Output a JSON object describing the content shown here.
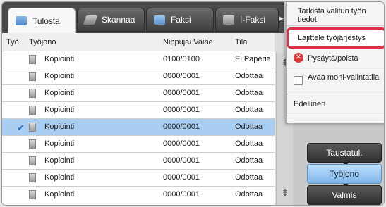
{
  "tabs": [
    {
      "label": "Tulosta",
      "icon": "print-icon",
      "active": true
    },
    {
      "label": "Skannaa",
      "icon": "scan-icon",
      "active": false
    },
    {
      "label": "Faksi",
      "icon": "fax-icon",
      "active": false
    },
    {
      "label": "I-Faksi",
      "icon": "ifax-icon",
      "active": false
    }
  ],
  "table": {
    "headers": [
      "Työ",
      "Työjono",
      "Nippuja/ Vaihe",
      "Tila"
    ],
    "rows": [
      {
        "name": "Kopiointi",
        "count": "0100/0100",
        "status": "Ei Paperia"
      },
      {
        "name": "Kopiointi",
        "count": "0000/0001",
        "status": "Odottaa"
      },
      {
        "name": "Kopiointi",
        "count": "0000/0001",
        "status": "Odottaa"
      },
      {
        "name": "Kopiointi",
        "count": "0000/0001",
        "status": "Odottaa"
      },
      {
        "name": "Kopiointi",
        "count": "0000/0001",
        "status": "Odottaa",
        "selected": true
      },
      {
        "name": "Kopiointi",
        "count": "0000/0001",
        "status": "Odottaa"
      },
      {
        "name": "Kopiointi",
        "count": "0000/0001",
        "status": "Odottaa"
      },
      {
        "name": "Kopiointi",
        "count": "0000/0001",
        "status": "Odottaa"
      },
      {
        "name": "Kopiointi",
        "count": "0000/0001",
        "status": "Odottaa"
      }
    ]
  },
  "menu": {
    "item_clipped": "Tarkista valitun työn tiedot",
    "item_sort": "Lajittele työjärjestys",
    "item_stop": "Pysäytä/poista",
    "item_multi": "Avaa moni-valintatila",
    "item_prev": "Edellinen"
  },
  "right_buttons": {
    "spool": "Taustatul.",
    "queue": "Työjono",
    "complete": "Valmis"
  },
  "colors": {
    "selected_row": "#a9cdf0",
    "highlight_border": "#e03045"
  }
}
